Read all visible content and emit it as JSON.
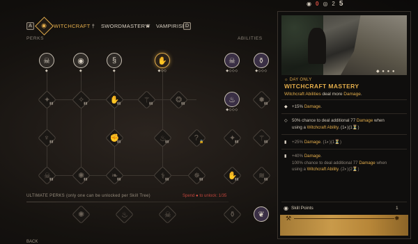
{
  "tabs": {
    "left_key": "A",
    "right_key": "D",
    "items": [
      {
        "label": "WITCHCRAFT",
        "icon": "eye-sigil-icon",
        "active": true
      },
      {
        "label": "SWORDMASTERY",
        "icon": "sword-icon",
        "active": false
      },
      {
        "label": "VAMPIRISM",
        "icon": "fang-icon",
        "active": false
      }
    ]
  },
  "sections": {
    "perks": "PERKS",
    "abilities": "ABILITIES"
  },
  "hud": {
    "counter_a": "0",
    "counter_b": "2",
    "counter_c": "5"
  },
  "ultimate": {
    "label": "ULTIMATE PERKS (only one can be unlocked per Skill Tree)",
    "spend_prefix": "Spend",
    "spend_suffix": "to unlock:",
    "spend_value": "1/35"
  },
  "detail": {
    "day_only": "DAY ONLY",
    "title": "WITCHCRAFT MASTERY",
    "desc_prefix": "Witchcraft Abilities",
    "desc_mid": " deal more ",
    "desc_keyword": "Damage",
    "desc_end": ".",
    "tiers": [
      {
        "line1_pre": "+15% ",
        "line1_kw": "Damage",
        "line1_post": ".",
        "line2": ""
      },
      {
        "line1_pre": "50% chance to deal additional 77 ",
        "line1_kw": "Damage",
        "line1_post": " when",
        "line2_pre": "using a ",
        "line2_kw": "Witchcraft Ability",
        "line2_post": ". (1◐)(1⏳)"
      },
      {
        "line1_pre": "+25% ",
        "line1_kw": "Damage",
        "line1_post": ". (1◐)(1⏳)",
        "line2": ""
      },
      {
        "line1_pre": "+40% ",
        "line1_kw": "Damage",
        "line1_post": ".",
        "line2_pre": "100% chance to deal additional 77 ",
        "line2_kw": "Damage",
        "line2_post": " when",
        "line3_pre": "using a ",
        "line3_kw": "Witchcraft Ability",
        "line3_post": ". (2◐)(2⏳)"
      }
    ],
    "skill_points_label": "Skill Points",
    "skill_points_value": "1",
    "slide_dots": "◆ ● ● ●"
  },
  "footer": {
    "back": "BACK"
  }
}
